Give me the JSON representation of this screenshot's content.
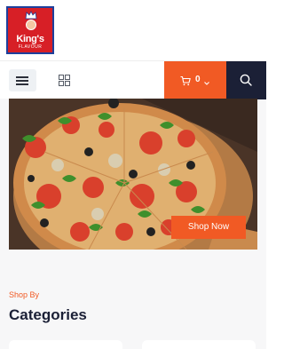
{
  "brand": {
    "name": "King's",
    "tagline": "FLAVOUR"
  },
  "header": {
    "menu_icon": "hamburger-icon",
    "grid_icon": "grid-view-icon",
    "cart": {
      "icon": "cart-icon",
      "count": "0",
      "chevron_icon": "chevron-down-icon"
    },
    "search_icon": "search-icon"
  },
  "hero": {
    "image": "pizza-photo",
    "cta_label": "Shop Now"
  },
  "categories_section": {
    "kicker": "Shop By",
    "title": "Categories"
  },
  "colors": {
    "accent": "#f15a24",
    "navy": "#1b2036",
    "logo_red": "#d71f26",
    "logo_blue": "#1d3f9c"
  }
}
